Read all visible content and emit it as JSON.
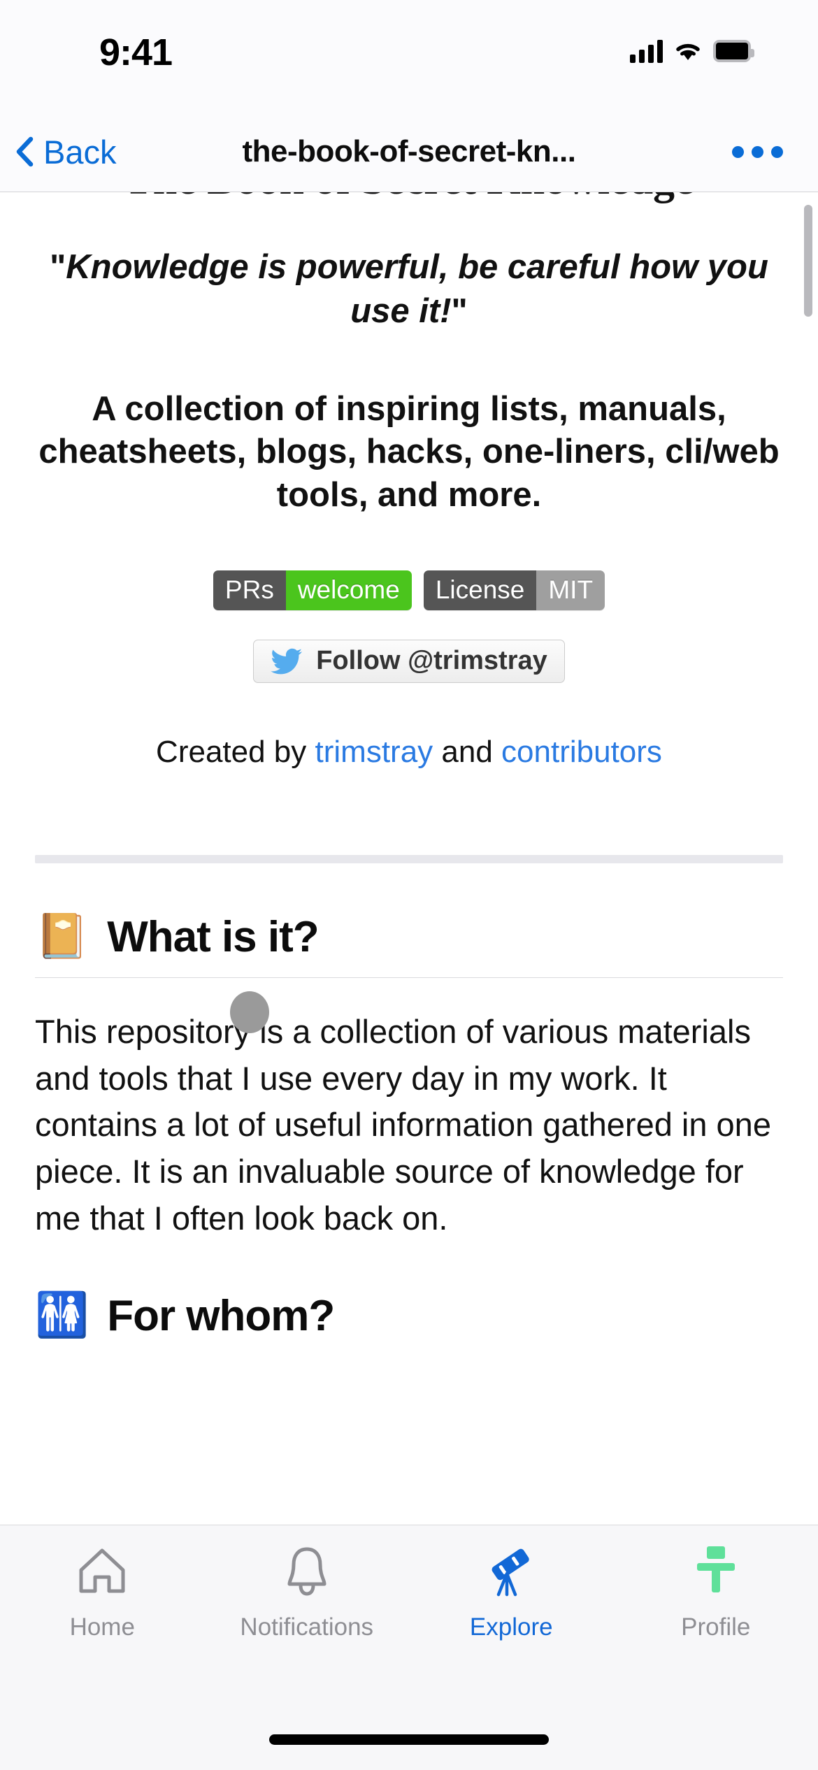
{
  "status_bar": {
    "time": "9:41",
    "cellular_icon": "signal-bars-icon",
    "wifi_icon": "wifi-icon",
    "battery_icon": "battery-full-icon"
  },
  "nav_bar": {
    "back_label": "Back",
    "back_icon": "chevron-left-icon",
    "title": "the-book-of-secret-kn...",
    "more_icon": "ellipsis-icon",
    "accent_color": "#0a6cd6"
  },
  "page": {
    "repo_title": "The Book of Secret Knowledge",
    "quote_open": "\"",
    "quote_text": "Knowledge is powerful, be careful how you use it!",
    "quote_close": "\"",
    "description": "A collection of inspiring lists, manuals, cheatsheets, blogs, hacks, one-liners, cli/web tools, and more.",
    "badges": [
      {
        "key": "PRs",
        "value": "welcome",
        "key_color": "#555555",
        "value_color": "#4bc51d"
      },
      {
        "key": "License",
        "value": "MIT",
        "key_color": "#555555",
        "value_color": "#9f9f9f"
      }
    ],
    "follow_button": {
      "label": "Follow @trimstray",
      "icon": "twitter-bird-icon",
      "icon_color": "#55acee"
    },
    "credit": {
      "prefix": "Created by ",
      "author": "trimstray",
      "middle": " and ",
      "contributors": "contributors",
      "link_color": "#2a7ae2"
    },
    "sections": [
      {
        "emoji": "📔",
        "emoji_name": "notebook-with-decorative-cover-emoji",
        "heading": "What is it?",
        "body": "This repository is a collection of various materials and tools that I use every day in my work. It contains a lot of useful information gathered in one piece. It is an invaluable source of knowledge for me that I often look back on."
      },
      {
        "emoji": "🚻",
        "emoji_name": "restroom-emoji",
        "heading": "For whom?",
        "body": ""
      }
    ]
  },
  "tab_bar": {
    "items": [
      {
        "label": "Home",
        "icon": "home-icon",
        "active": false
      },
      {
        "label": "Notifications",
        "icon": "bell-icon",
        "active": false
      },
      {
        "label": "Explore",
        "icon": "telescope-icon",
        "active": true
      },
      {
        "label": "Profile",
        "icon": "profile-icon",
        "active": false
      }
    ],
    "active_color": "#1268d6",
    "inactive_color": "#8e8e93"
  }
}
